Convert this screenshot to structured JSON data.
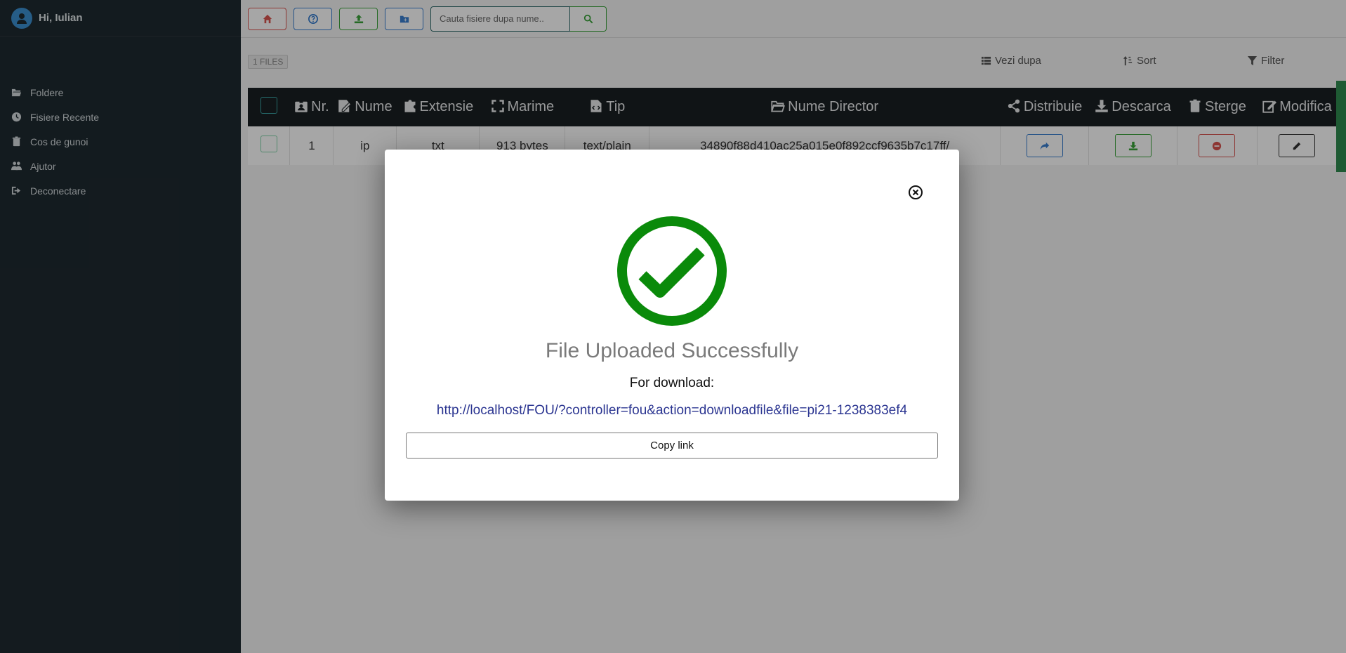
{
  "sidebar": {
    "greeting": "Hi, Iulian",
    "items": [
      {
        "label": "Foldere",
        "icon": "folder-open-icon"
      },
      {
        "label": "Fisiere Recente",
        "icon": "clock-icon"
      },
      {
        "label": "Cos de gunoi",
        "icon": "trash-icon"
      },
      {
        "label": "Ajutor",
        "icon": "help-icon"
      },
      {
        "label": "Deconectare",
        "icon": "sign-out-icon"
      }
    ]
  },
  "toolbar": {
    "buttons": [
      {
        "icon": "home-icon",
        "color": "#d9534f"
      },
      {
        "icon": "question-icon",
        "color": "#3a7fd0"
      },
      {
        "icon": "upload-icon",
        "color": "#3aa33a"
      },
      {
        "icon": "new-folder-icon",
        "color": "#3a7fd0"
      }
    ],
    "search_placeholder": "Cauta fisiere dupa nume.."
  },
  "info": {
    "files_count": "1 FILES",
    "view_label": "Vezi dupa",
    "sort_label": "Sort",
    "filter_label": "Filter"
  },
  "table": {
    "headers": [
      "Nr.",
      "Nume",
      "Extensie",
      "Marime",
      "Tip",
      "Nume Director",
      "Distribuie",
      "Descarca",
      "Sterge",
      "Modifica"
    ],
    "rows": [
      {
        "nr": "1",
        "nume": "ip",
        "extensie": "txt",
        "marime": "913 bytes",
        "tip": "text/plain",
        "director": "34890f88d410ac25a015e0f892ccf9635b7c17ff/"
      }
    ]
  },
  "modal": {
    "title": "File Uploaded Successfully",
    "subtitle": "For download:",
    "link": "http://localhost/FOU/?controller=fou&action=downloadfile&file=pi21-1238383ef4",
    "copy_label": "Copy link",
    "success_color": "#0a8a0a"
  }
}
